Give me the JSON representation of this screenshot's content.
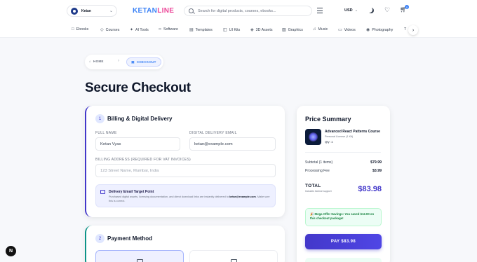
{
  "header": {
    "user_name": "Ketan",
    "logo_part1": "KETAN",
    "logo_part2": "LINE",
    "search_placeholder": "Search for digital products, courses, ebooks...",
    "currency": "USD",
    "cart_count": "0",
    "icons": [
      "filter-icon",
      "moon-icon",
      "heart-icon",
      "cart-icon"
    ]
  },
  "categories": [
    {
      "label": "Ebooks",
      "icon": "□"
    },
    {
      "label": "Courses",
      "icon": "◇"
    },
    {
      "label": "AI Tools",
      "icon": "✦"
    },
    {
      "label": "Software",
      "icon": "‹›"
    },
    {
      "label": "Templates",
      "icon": "▤"
    },
    {
      "label": "UI Kits",
      "icon": "◫"
    },
    {
      "label": "3D Assets",
      "icon": "◈"
    },
    {
      "label": "Graphics",
      "icon": "▨"
    },
    {
      "label": "Music",
      "icon": "♫"
    },
    {
      "label": "Videos",
      "icon": "▭"
    },
    {
      "label": "Photography",
      "icon": "◉"
    },
    {
      "label": "T",
      "icon": "T"
    }
  ],
  "breadcrumb": {
    "home": "HOME",
    "current": "CHECKOUT"
  },
  "page_title": "Secure Checkout",
  "billing": {
    "step": "1",
    "title": "Billing & Digital Delivery",
    "full_name_label": "FULL NAME",
    "full_name_value": "Ketan Vyas",
    "email_label": "DIGITAL DELIVERY EMAIL",
    "email_value": "ketan@example.com",
    "address_label": "BILLING ADDRESS (REQUIRED FOR VAT INVOICES)",
    "address_placeholder": "123 Street Name, Mumbai, India",
    "info_title": "Delivery Email Target Point",
    "info_text_pre": "Purchased digital assets, licensing documentation, and direct download links are instantly delivered to ",
    "info_email": "ketan@example.com",
    "info_text_post": ". Make sure this is correct."
  },
  "payment": {
    "step": "2",
    "title": "Payment Method"
  },
  "summary": {
    "title": "Price Summary",
    "product_name": "Advanced React Patterns Course",
    "product_license": "Personal License (1 Kit)",
    "product_qty": "Qty: 1",
    "subtotal_label": "Subtotal (1 items)",
    "subtotal_value": "$79.99",
    "fee_label": "Processing Fee",
    "fee_value": "$3.99",
    "total_label": "TOTAL",
    "total_sub": "Includes license support",
    "total_value": "$83.98",
    "offer_text": "🎉 Mega Offer Savings: You saved $12.00 on this checkout package!",
    "pay_label": "PAY $83.98"
  },
  "fab_letter": "N"
}
